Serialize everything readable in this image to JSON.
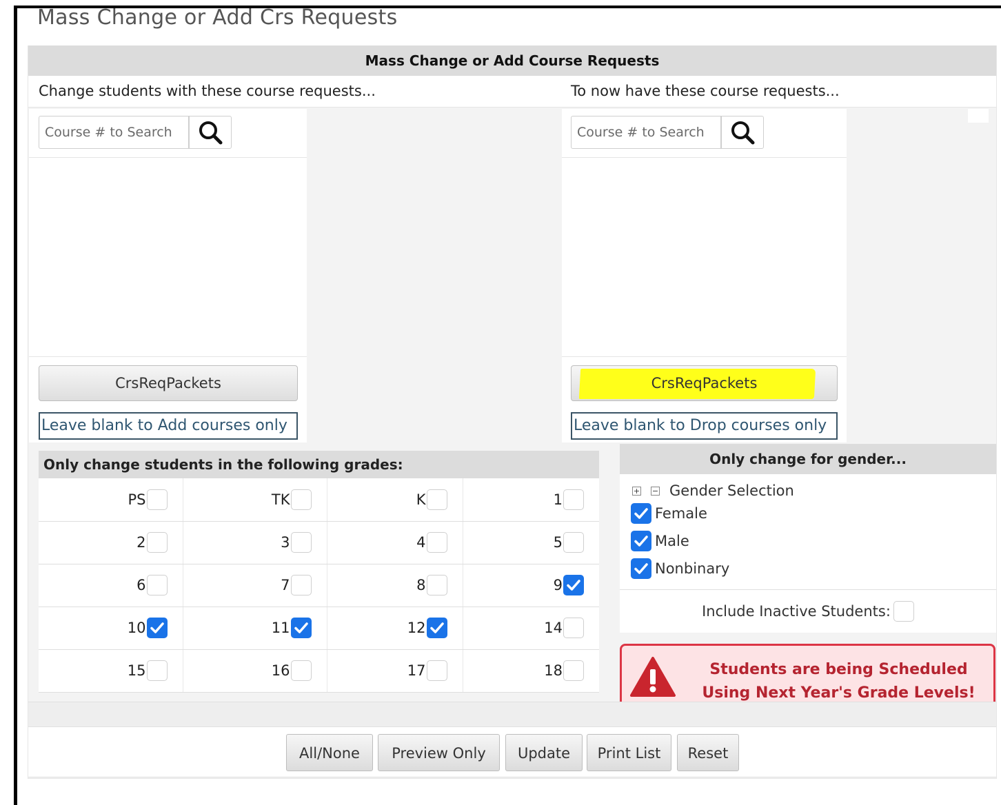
{
  "page": {
    "title": "Mass Change or Add Crs Requests"
  },
  "panel": {
    "header": "Mass Change or Add Course Requests"
  },
  "left": {
    "heading": "Change students with these course requests...",
    "search_placeholder": "Course # to Search",
    "packets_label": "CrsReqPackets",
    "blank_label": "Leave blank to Add courses only"
  },
  "right": {
    "heading": "To now have these course requests...",
    "search_placeholder": "Course # to Search",
    "packets_label": "CrsReqPackets",
    "blank_label": "Leave blank to Drop courses only"
  },
  "grades": {
    "heading": "Only change students in the following grades:",
    "rows": [
      [
        {
          "label": "PS",
          "checked": false
        },
        {
          "label": "TK",
          "checked": false
        },
        {
          "label": "K",
          "checked": false
        },
        {
          "label": "1",
          "checked": false
        }
      ],
      [
        {
          "label": "2",
          "checked": false
        },
        {
          "label": "3",
          "checked": false
        },
        {
          "label": "4",
          "checked": false
        },
        {
          "label": "5",
          "checked": false
        }
      ],
      [
        {
          "label": "6",
          "checked": false
        },
        {
          "label": "7",
          "checked": false
        },
        {
          "label": "8",
          "checked": false
        },
        {
          "label": "9",
          "checked": true
        }
      ],
      [
        {
          "label": "10",
          "checked": true
        },
        {
          "label": "11",
          "checked": true
        },
        {
          "label": "12",
          "checked": true
        },
        {
          "label": "14",
          "checked": false
        }
      ],
      [
        {
          "label": "15",
          "checked": false
        },
        {
          "label": "16",
          "checked": false
        },
        {
          "label": "17",
          "checked": false
        },
        {
          "label": "18",
          "checked": false
        }
      ]
    ]
  },
  "gender": {
    "heading": "Only change for gender...",
    "tree_label": "Gender Selection",
    "options": [
      {
        "label": "Female",
        "checked": true
      },
      {
        "label": "Male",
        "checked": true
      },
      {
        "label": "Nonbinary",
        "checked": true
      }
    ],
    "inactive_label": "Include Inactive Students:",
    "inactive_checked": false
  },
  "alert": {
    "line1": "Students are being Scheduled",
    "line2": "Using Next Year's Grade Levels!",
    "color": "#dc3545"
  },
  "actions": {
    "all_none": "All/None",
    "preview": "Preview Only",
    "update": "Update",
    "print": "Print List",
    "reset": "Reset"
  },
  "colors": {
    "checkbox_checked": "#1a73e8",
    "highlight": "#ffff1a"
  }
}
